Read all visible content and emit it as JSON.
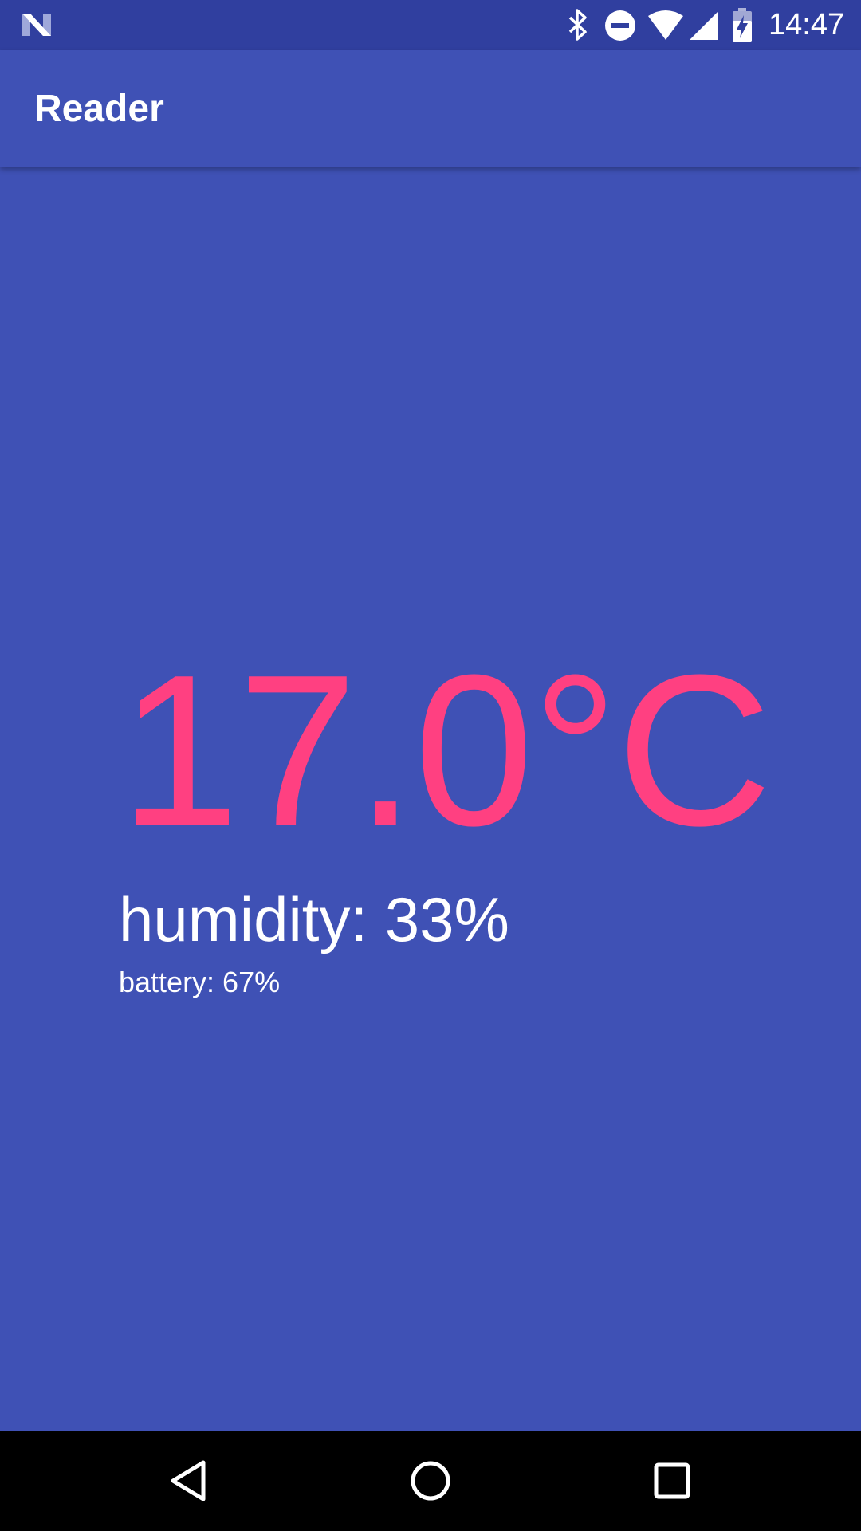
{
  "status_bar": {
    "time": "14:47",
    "icons": [
      "android-n-icon",
      "bluetooth-icon",
      "do-not-disturb-icon",
      "wifi-icon",
      "cell-signal-icon",
      "battery-charging-icon"
    ]
  },
  "app_bar": {
    "title": "Reader"
  },
  "reading": {
    "temperature": "17.0°C",
    "humidity": "humidity: 33%",
    "battery": "battery: 67%"
  },
  "nav_bar": {
    "buttons": [
      "back-icon",
      "home-icon",
      "recents-icon"
    ]
  },
  "colors": {
    "primary": "#3F51B5",
    "primary_dark": "#303F9F",
    "accent": "#FF4081",
    "text": "#FFFFFF"
  }
}
